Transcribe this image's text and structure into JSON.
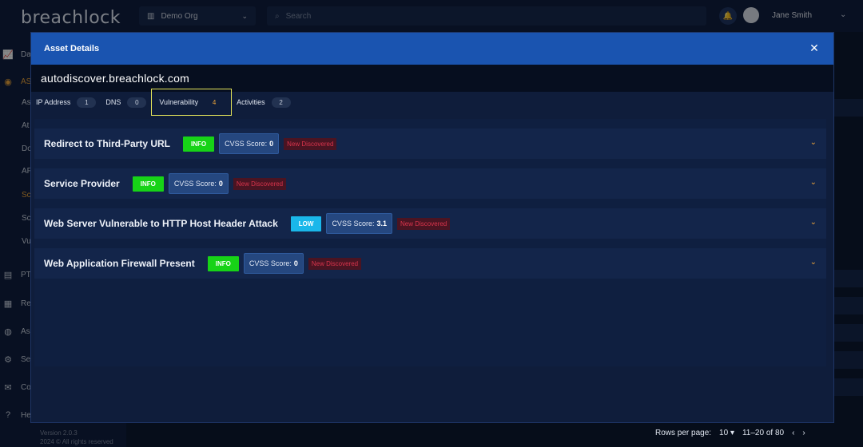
{
  "app": {
    "logo": "breachlock",
    "org_selector": "Demo Org",
    "search_placeholder": "Search",
    "user_name": "Jane Smith",
    "sidebar": {
      "items": [
        {
          "label": "Da",
          "icon": "chart-icon"
        },
        {
          "label": "AS",
          "icon": "target-icon"
        },
        {
          "label": "As",
          "icon": ""
        },
        {
          "label": "At",
          "icon": ""
        },
        {
          "label": "Do",
          "icon": ""
        },
        {
          "label": "AP",
          "icon": ""
        },
        {
          "label": "Sc",
          "icon": ""
        },
        {
          "label": "Sc",
          "icon": ""
        },
        {
          "label": "Vu",
          "icon": ""
        },
        {
          "label": "PT",
          "icon": "document-icon"
        },
        {
          "label": "Re",
          "icon": "report-icon"
        },
        {
          "label": "As",
          "icon": "globe-icon"
        },
        {
          "label": "Se",
          "icon": "gear-icon"
        },
        {
          "label": "Co",
          "icon": "chat-icon"
        },
        {
          "label": "He",
          "icon": "help-icon"
        }
      ],
      "version": "Version 2.0.3",
      "copyright": "2024 © All rights reserved"
    },
    "footer": {
      "rows_per_page_label": "Rows per page:",
      "rows_per_page_value": "10",
      "range": "11–20 of 80",
      "prev": "‹",
      "next": "›"
    }
  },
  "modal": {
    "title": "Asset Details",
    "asset_name": "autodiscover.breachlock.com",
    "tabs": [
      {
        "label": "IP Address",
        "count": "1"
      },
      {
        "label": "DNS",
        "count": "0"
      },
      {
        "label": "Vulnerability",
        "count": "4",
        "active": true
      },
      {
        "label": "Activities",
        "count": "2"
      }
    ],
    "vulnerabilities": [
      {
        "title": "Redirect to Third-Party URL",
        "severity": "INFO",
        "cvss_label": "CVSS Score:",
        "cvss_value": "0",
        "status": "New Discovered"
      },
      {
        "title": "Service Provider",
        "severity": "INFO",
        "cvss_label": "CVSS Score:",
        "cvss_value": "0",
        "status": "New Discovered"
      },
      {
        "title": "Web Server Vulnerable to HTTP Host Header Attack",
        "severity": "LOW",
        "cvss_label": "CVSS Score:",
        "cvss_value": "3.1",
        "status": "New Discovered"
      },
      {
        "title": "Web Application Firewall Present",
        "severity": "INFO",
        "cvss_label": "CVSS Score:",
        "cvss_value": "0",
        "status": "New Discovered"
      }
    ]
  },
  "colors": {
    "accent": "#1a54b0",
    "info": "#17d317",
    "low": "#1ab7ea",
    "warning": "#e8a23a",
    "danger": "#d8344c"
  }
}
